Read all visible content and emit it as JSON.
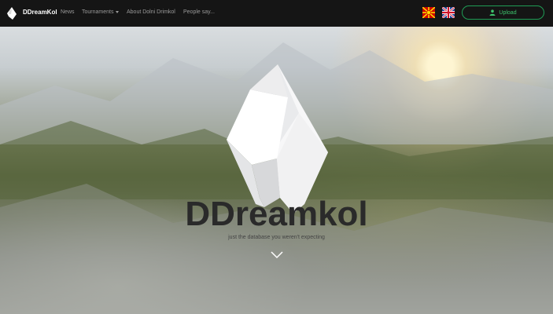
{
  "nav": {
    "brand": "DDreamKol",
    "items": [
      {
        "label": "News"
      },
      {
        "label": "Tournaments",
        "has_dropdown": true
      },
      {
        "label": "About Dolni Drimkol"
      },
      {
        "label": "People say..."
      }
    ],
    "languages": [
      {
        "name": "Macedonian",
        "icon": "flag-mk-icon"
      },
      {
        "name": "English",
        "icon": "flag-uk-icon"
      }
    ],
    "upload_label": "Upload",
    "upload_icon": "user-upload-icon",
    "colors": {
      "bar": "#151515",
      "upload": "#1f9d55"
    }
  },
  "hero": {
    "title": "DDreamkol",
    "tagline": "just the database you weren't expecting",
    "scroll_icon": "chevron-down-icon"
  }
}
